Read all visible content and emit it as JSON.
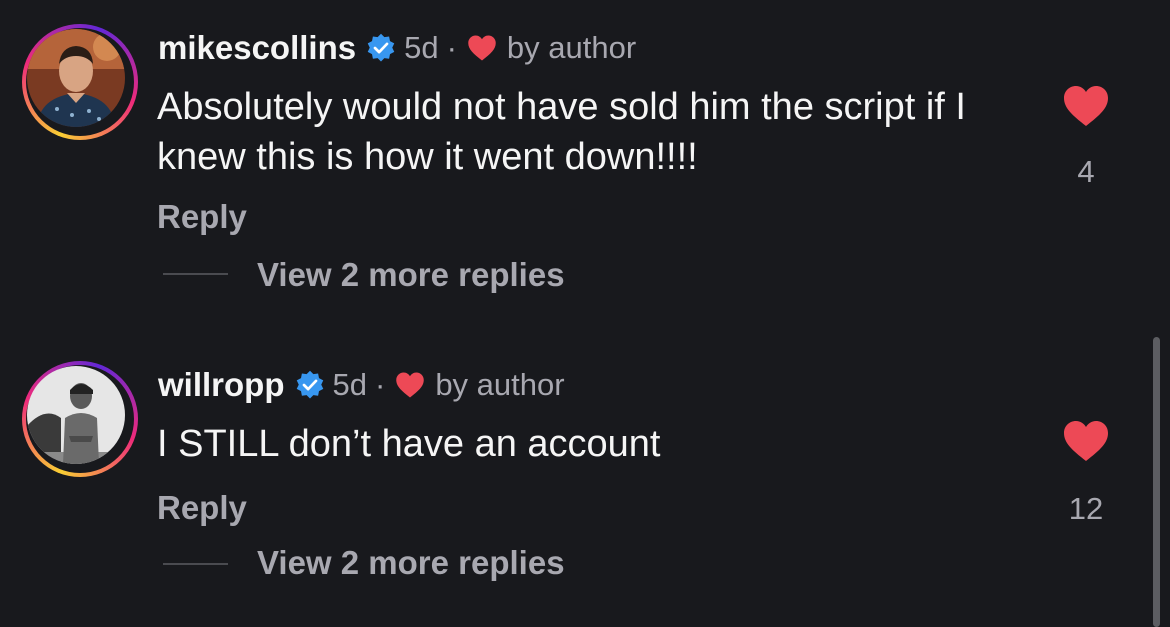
{
  "comments": [
    {
      "username": "mikescollins",
      "age": "5d",
      "separator": "·",
      "author_like": "by author",
      "text": "Absolutely would not have sold him the script if I knew this is how it went down!!!!",
      "reply_label": "Reply",
      "view_more": "View 2 more replies",
      "like_count": "4"
    },
    {
      "username": "willropp",
      "age": "5d",
      "separator": "·",
      "author_like": "by author",
      "text": "I STILL don’t have an account",
      "reply_label": "Reply",
      "view_more": "View 2 more replies",
      "like_count": "12"
    }
  ],
  "colors": {
    "background": "#18191d",
    "verified": "#3897f0",
    "heart": "#ed4956",
    "secondary_text": "#a8a8b0"
  },
  "icons": {
    "verified": "verified-badge-icon",
    "author_heart": "heart-icon",
    "like": "heart-filled-icon"
  }
}
